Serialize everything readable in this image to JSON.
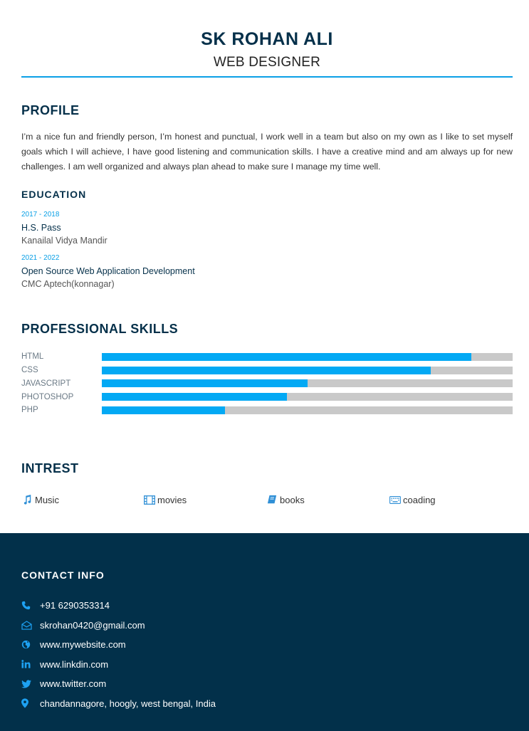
{
  "header": {
    "name": "SK ROHAN ALI",
    "title": "WEB DESIGNER"
  },
  "profile": {
    "heading": "PROFILE",
    "text": "I’m a nice fun and friendly person, I’m honest and punctual, I work well in a team but also on my own as I like to set myself goals which I will achieve, I have good listening and communication skills. I have a creative mind and am always up for new challenges. I am well organized and always plan ahead to make sure I manage my time well."
  },
  "education": {
    "heading": "EDUCATION",
    "items": [
      {
        "years": "2017 - 2018",
        "degree": "H.S. Pass",
        "school": "Kanailal Vidya Mandir"
      },
      {
        "years": "2021 - 2022",
        "degree": "Open Source Web Application Development",
        "school": "CMC Aptech(konnagar)"
      }
    ]
  },
  "skills": {
    "heading": "PROFESSIONAL SKILLS",
    "items": [
      {
        "name": "HTML",
        "level": 90
      },
      {
        "name": "CSS",
        "level": 80
      },
      {
        "name": "JAVASCRIPT",
        "level": 50
      },
      {
        "name": "PHOTOSHOP",
        "level": 45
      },
      {
        "name": "PHP",
        "level": 30
      }
    ]
  },
  "interests": {
    "heading": "INTREST",
    "items": [
      {
        "label": "Music",
        "icon": "music-icon"
      },
      {
        "label": "movies",
        "icon": "film-icon"
      },
      {
        "label": "books",
        "icon": "book-icon"
      },
      {
        "label": "coading",
        "icon": "keyboard-icon"
      }
    ]
  },
  "contact": {
    "heading": "CONTACT INFO",
    "items": [
      {
        "text": "+91 6290353314",
        "icon": "phone-icon"
      },
      {
        "text": "skrohan0420@gmail.com",
        "icon": "envelope-icon"
      },
      {
        "text": "www.mywebsite.com",
        "icon": "globe-icon"
      },
      {
        "text": "www.linkdin.com",
        "icon": "linkedin-icon"
      },
      {
        "text": "www.twitter.com",
        "icon": "twitter-icon"
      },
      {
        "text": "chandannagore, hoogly, west bengal, India",
        "icon": "map-marker-icon"
      }
    ]
  },
  "colors": {
    "accent": "#03a9f4",
    "dark": "#02304a",
    "bar_track": "#c9c9c9"
  }
}
